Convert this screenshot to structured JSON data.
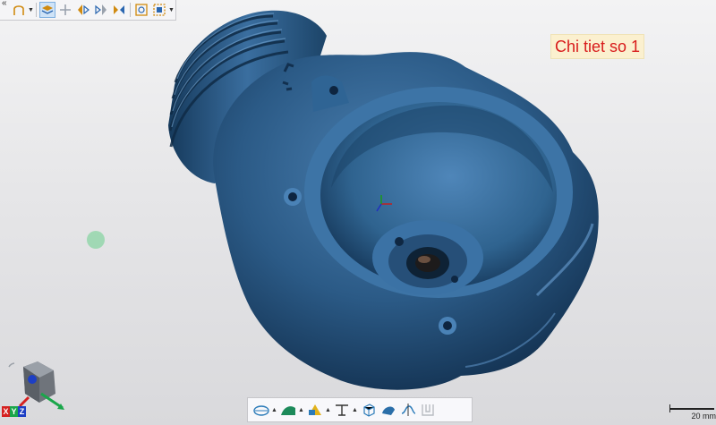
{
  "label": {
    "text": "Chi tiet so 1"
  },
  "scale": {
    "text": "20 mm"
  },
  "axis": {
    "x": "X",
    "y": "Y",
    "z": "Z"
  },
  "top_toolbar": {
    "collapse": "«",
    "tools": [
      "select-shape-icon",
      "view-layers-icon",
      "move-icon",
      "flip-left-icon",
      "flip-right-icon",
      "mirror-icon",
      "frame-all-icon",
      "frame-selection-icon"
    ]
  },
  "bottom_toolbar": {
    "tools": [
      "section-view-icon",
      "surface-icon",
      "color-mapping-icon",
      "measure-icon",
      "bounding-box-icon",
      "solid-view-icon",
      "curve-icon",
      "profile-icon"
    ]
  },
  "colors": {
    "part": "#2a5882",
    "label_bg": "#fbf0cf",
    "label_text": "#d81b1b"
  }
}
